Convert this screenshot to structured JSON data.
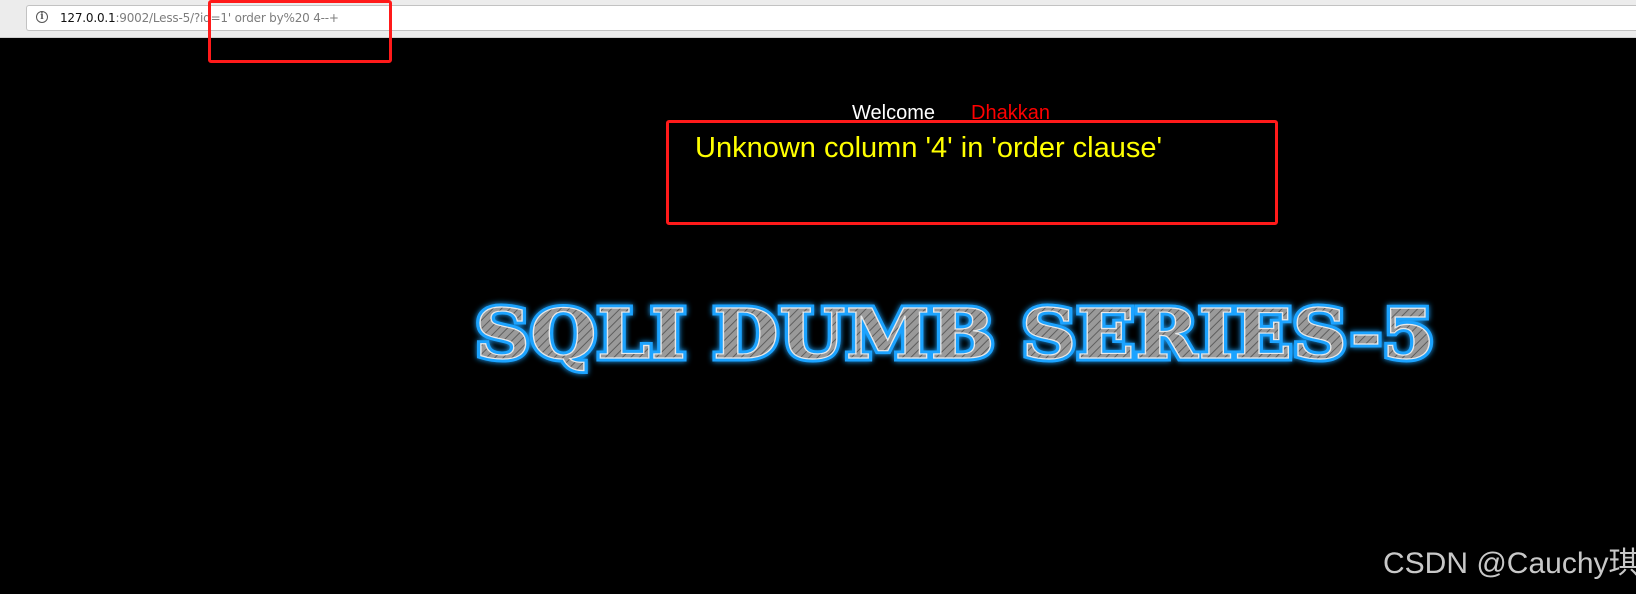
{
  "browser": {
    "url_host": "127.0.0.1",
    "url_rest": ":9002/Less-5/?id=1' order by%20 4--+"
  },
  "page": {
    "welcome_label": "Welcome",
    "welcome_name": "Dhakkan",
    "error_message": "Unknown column '4' in 'order clause'",
    "banner_text": "SQLI DUMB SERIES-5"
  },
  "watermark": "CSDN @Cauchy琪",
  "colors": {
    "background": "#000000",
    "welcome": "#ffffff",
    "welcome_name": "#ff0000",
    "error": "#ffff00",
    "annotation": "#ff1a1a",
    "banner_glow": "#1aa3ff"
  }
}
